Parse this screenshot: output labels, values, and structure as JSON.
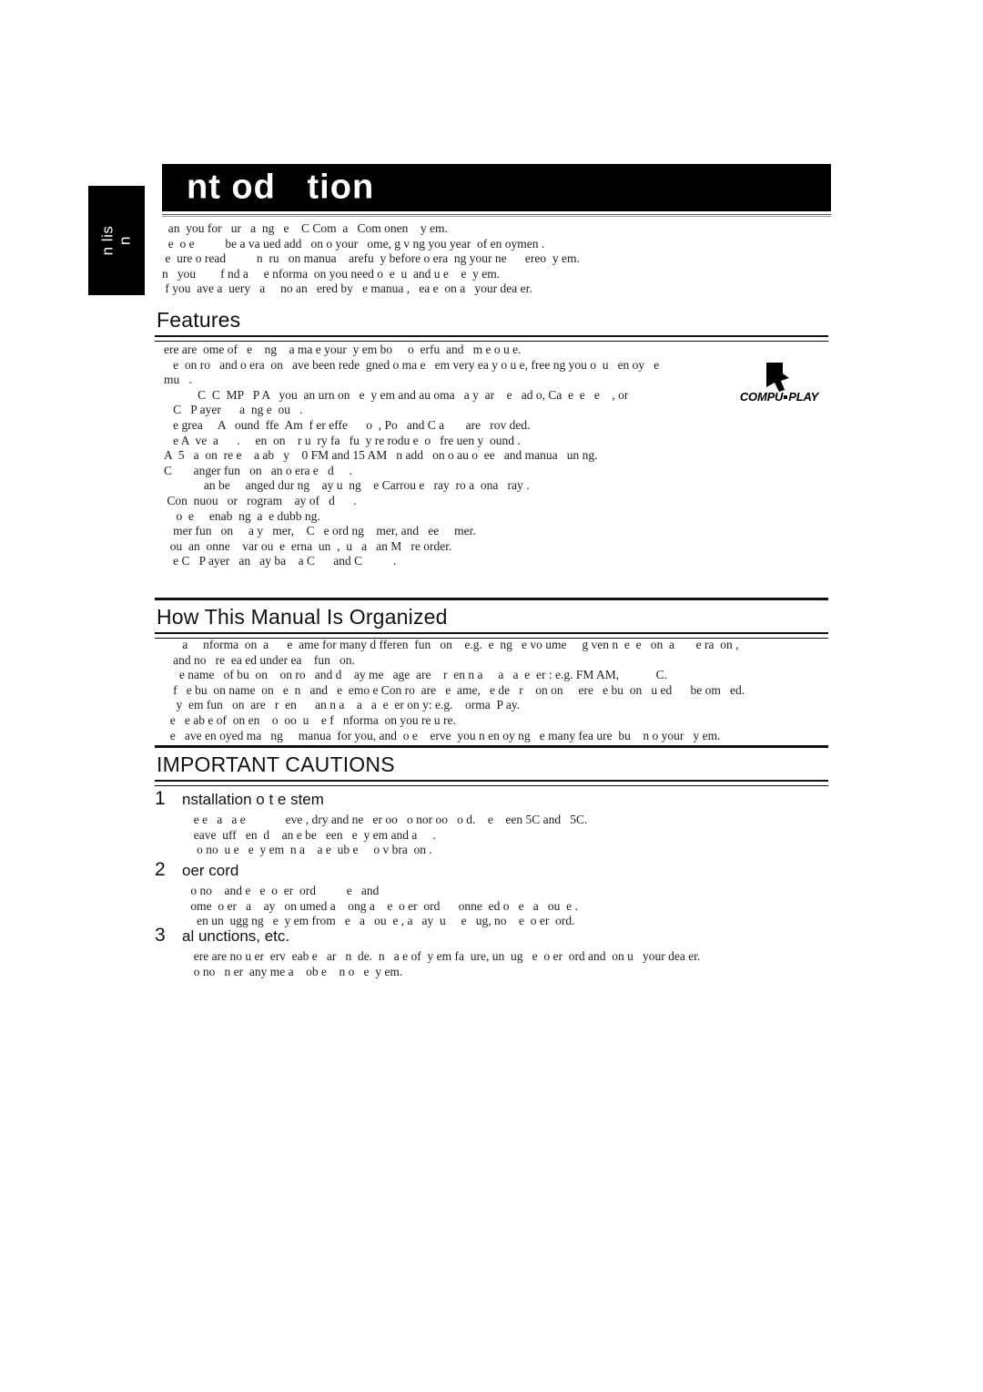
{
  "page": {
    "language_tab": {
      "line1": "n lis",
      "line2": "n"
    },
    "title": "nt od   tion"
  },
  "intro": {
    "lines": [
      "  an  you for   ur   a  ng   e    C Com  a   Com onen    y em.",
      "  e  o e          be a va ued add   on o your   ome, g v ng you year  of en oymen .",
      " e  ure o read          n  ru   on manua    arefu  y before o era  ng your ne      ereo  y em.",
      "n   you        f nd a     e nforma  on you need o  e  u  and u e    e  y em.",
      " f you  ave a  uery   a     no an   ered by   e manua ,   ea e  on a   your dea er."
    ]
  },
  "features": {
    "heading": "Features",
    "lines": [
      "ere are  ome of   e    ng    a ma e your  y em bo     o  erfu  and   m e o u e.",
      "   e  on ro   and o era  on   ave been rede  gned o ma e   em very ea y o u e, free ng you o  u   en oy   e",
      "mu   .",
      "           C  C  MP   P A   you  an urn on   e  y em and au oma   a y  ar    e   ad o, Ca  e  e   e    , or",
      "   C   P ayer      a  ng e  ou   .",
      "   e grea     A   ound  ffe  Am  f er effe      o  , Po   and C a       are   rov ded.",
      "   e A  ve  a      .     en  on    r u  ry fa   fu  y re rodu e  o   fre uen y  ound .",
      "A  5   a  on  re e    a ab   y    0 FM and 15 AM   n add   on o au o  ee   and manua   un ng.",
      "C       anger fun   on   an o era e   d     .",
      "             an be     anged dur ng    ay u  ng    e Carrou e   ray  ro a  ona   ray .",
      " Con  nuou   or   rogram    ay of   d      .",
      "    o  e     enab  ng  a  e dubb ng.",
      "   mer fun   on     a y   mer,    C   e ord ng    mer, and   ee     mer.",
      "  ou  an  onne    var ou  e  erna  un  ,  u   a   an M   re order.",
      "   e C   P ayer   an   ay ba    a C      and C          ."
    ],
    "logo": {
      "name": "COMPU PLAY",
      "text_left": "COMPU",
      "text_right": "PLAY"
    }
  },
  "manual": {
    "heading": "How This Manual Is Organized",
    "lines": [
      "      a     nforma  on  a      e  ame for many d fferen  fun   on    e.g.  e  ng   e vo ume     g ven n  e  e   on  a       e ra  on ,",
      "   and no   re  ea ed under ea    fun   on.",
      "     e name   of bu  on    on ro   and d    ay me   age  are    r  en n a     a   a  e  er : e.g. FM AM,            C.",
      "   f   e bu  on name  on   e  n   and   e  emo e Con ro  are   e  ame,   e de   r    on on     ere   e bu  on   u ed      be om   ed.",
      "    y  em fun   on  are   r  en      an n a    a   a  e  er on y: e.g.    orma  P ay.",
      "  e   e ab e of  on en    o  oo  u    e f   nforma  on you re u re.",
      "  e   ave en oyed ma   ng     manua  for you, and  o e    erve  you n en oy ng   e many fea ure  bu    n o your   y em."
    ]
  },
  "cautions": {
    "heading": "IMPORTANT CAUTIONS",
    "items": [
      {
        "number": "1",
        "title": "nstallation o  t e   stem",
        "lines": [
          "  e e   a   a e             eve , dry and ne   er oo   o nor oo   o d.    e    een 5C and   5C.",
          "  eave  uff   en  d    an e be   een   e  y em and a     .",
          "   o no  u e   e  y em  n a    a e  ub e     o v bra  on ."
        ]
      },
      {
        "number": "2",
        "title": " oer  cord",
        "lines": [
          " o no    and e   e  o  er  ord          e   and",
          " ome  o er   a    ay   on umed a    ong a    e  o er  ord      onne  ed o   e   a   ou  e .",
          "   en un  ugg ng   e  y em from   e   a   ou  e , a   ay  u     e   ug, no    e  o er  ord."
        ]
      },
      {
        "number": "3",
        "title": " al  unctions, etc.",
        "lines": [
          "  ere are no u er  erv  eab e   ar   n  de.  n   a e of  y em fa  ure, un  ug   e  o er  ord and  on u   your dea er.",
          "  o no   n er  any me a    ob e    n o   e  y em."
        ]
      }
    ]
  },
  "colors": {
    "ink": "#1a1a1a",
    "bar": "#000000",
    "paper": "#ffffff"
  }
}
